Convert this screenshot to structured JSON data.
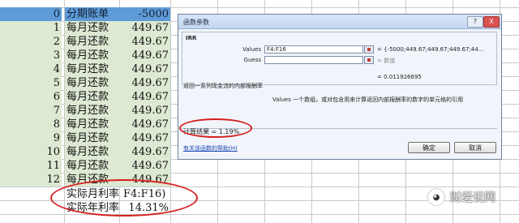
{
  "sheet": {
    "rows": [
      {
        "idx": "0",
        "desc": "分期账单",
        "amt": "-5000"
      },
      {
        "idx": "1",
        "desc": "每月还款",
        "amt": "449.67"
      },
      {
        "idx": "2",
        "desc": "每月还款",
        "amt": "449.67"
      },
      {
        "idx": "3",
        "desc": "每月还款",
        "amt": "449.67"
      },
      {
        "idx": "4",
        "desc": "每月还款",
        "amt": "449.67"
      },
      {
        "idx": "5",
        "desc": "每月还款",
        "amt": "449.67"
      },
      {
        "idx": "6",
        "desc": "每月还款",
        "amt": "449.67"
      },
      {
        "idx": "7",
        "desc": "每月还款",
        "amt": "449.67"
      },
      {
        "idx": "8",
        "desc": "每月还款",
        "amt": "449.67"
      },
      {
        "idx": "9",
        "desc": "每月还款",
        "amt": "449.67"
      },
      {
        "idx": "10",
        "desc": "每月还款",
        "amt": "449.67"
      },
      {
        "idx": "11",
        "desc": "每月还款",
        "amt": "449.67"
      },
      {
        "idx": "12",
        "desc": "每月还款",
        "amt": "449.67"
      }
    ],
    "monthly_rate": {
      "label": "实际月利率",
      "value": "F4:F16)"
    },
    "annual_rate": {
      "label": "实际年利率",
      "value": "14.31%"
    }
  },
  "dialog": {
    "title": "函数参数",
    "help_btn": "?",
    "close_btn": "X",
    "function_name": "IRR",
    "params": [
      {
        "label": "Values",
        "input": "F4:F16",
        "result": "= {-5000;449.67;449.67;449.67;44..."
      },
      {
        "label": "Guess",
        "input": "",
        "result": "= 数值"
      }
    ],
    "total_result": "= 0.011926695",
    "description": "返回一系列现金流的内部报酬率",
    "param_help": "Values  一个数组，或对包含用来计算返回内部报酬率的数字的单元格的引用",
    "calc_result": "计算结果 = 1.19%",
    "help_link": "有关该函数的帮助(H)",
    "ok": "确定",
    "cancel": "取消"
  },
  "watermark": {
    "icon": "wechat-icon",
    "text": "财经说网"
  },
  "colors": {
    "header": "#5f9bd6",
    "band": "#dde9d2",
    "annotation": "#d61f1f"
  }
}
